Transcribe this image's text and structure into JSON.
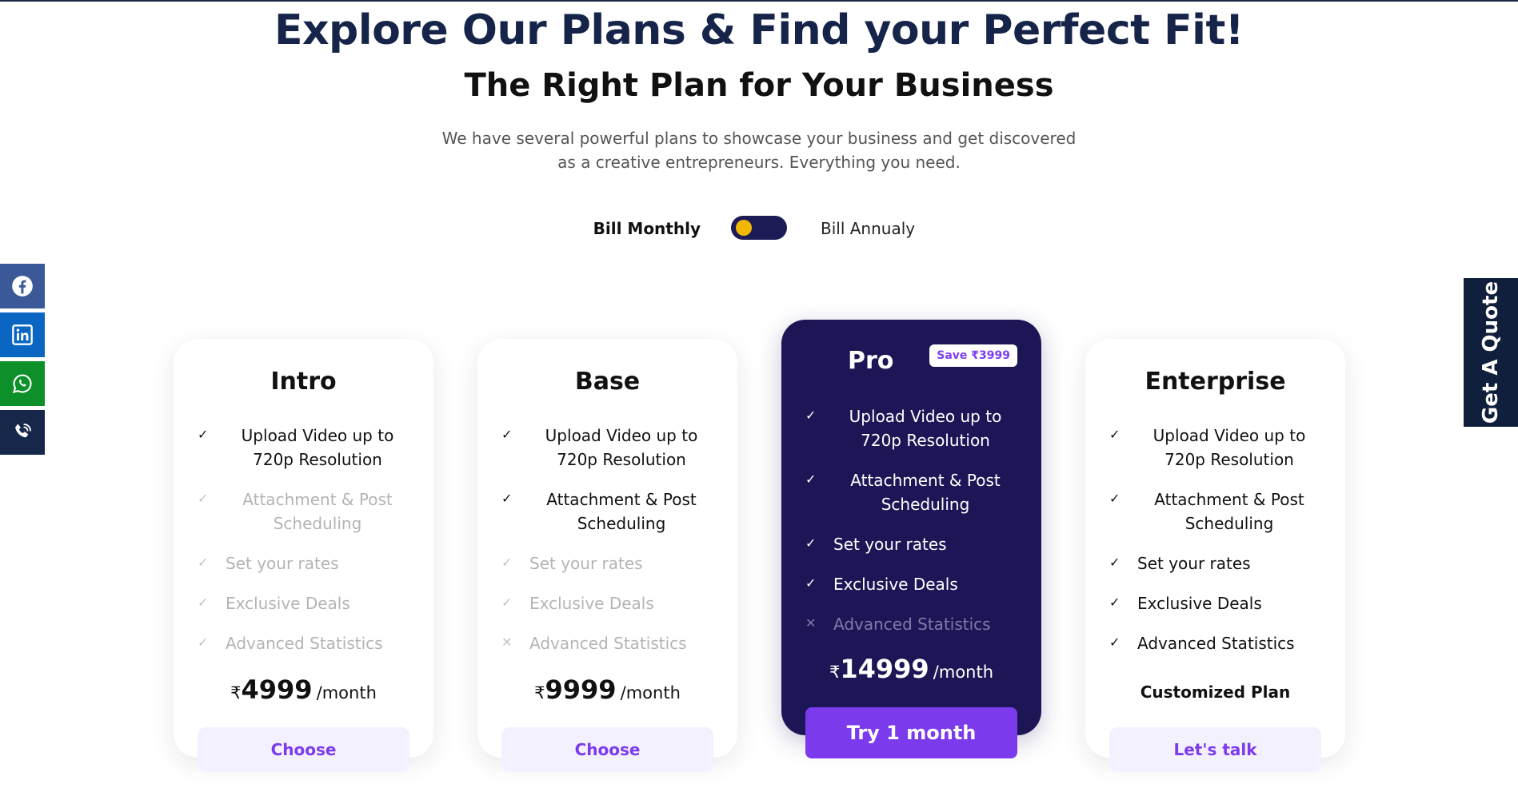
{
  "header": {
    "title": "Explore Our Plans & Find your Perfect Fit!",
    "subtitle": "The Right Plan for Your Business",
    "description_line1": "We have several powerful plans to showcase your business and get discovered",
    "description_line2": "as a creative entrepreneurs. Everything you need."
  },
  "billing": {
    "monthly_label": "Bill Monthly",
    "annual_label": "Bill Annualy",
    "selected": "monthly",
    "toggle_color": "#1d1b56",
    "knob_color": "#f2b705"
  },
  "social": [
    {
      "name": "facebook",
      "icon": "facebook-icon",
      "color": "#3b5998"
    },
    {
      "name": "linkedin",
      "icon": "linkedin-icon",
      "color": "#0a66c2"
    },
    {
      "name": "whatsapp",
      "icon": "whatsapp-icon",
      "color": "#0d8f2a"
    },
    {
      "name": "phone",
      "icon": "phone-icon",
      "color": "#16274a"
    }
  ],
  "quote_tab": {
    "label": "Get A Quote",
    "color": "#0f1f3c"
  },
  "currency_symbol": "₹",
  "plans": {
    "intro": {
      "name": "Intro",
      "features": [
        {
          "label": "Upload Video up to 720p Resolution",
          "line1": "Upload Video up to",
          "line2": "720p Resolution",
          "included": true
        },
        {
          "label": "Attachment & Post Scheduling",
          "line1": "Attachment & Post",
          "line2": "Scheduling",
          "included": false,
          "icon": "check"
        },
        {
          "label": "Set your rates",
          "included": false,
          "icon": "check"
        },
        {
          "label": "Exclusive Deals",
          "included": false,
          "icon": "check"
        },
        {
          "label": "Advanced Statistics",
          "included": false,
          "icon": "check"
        }
      ],
      "price": "4999",
      "period": "/month",
      "button": "Choose"
    },
    "base": {
      "name": "Base",
      "features": [
        {
          "label": "Upload Video up to 720p Resolution",
          "line1": "Upload Video up to",
          "line2": "720p Resolution",
          "included": true
        },
        {
          "label": "Attachment & Post Scheduling",
          "line1": "Attachment & Post",
          "line2": "Scheduling",
          "included": true
        },
        {
          "label": "Set your rates",
          "included": false,
          "icon": "check"
        },
        {
          "label": "Exclusive Deals",
          "included": false,
          "icon": "check"
        },
        {
          "label": "Advanced Statistics",
          "included": false,
          "icon": "cross"
        }
      ],
      "price": "9999",
      "period": "/month",
      "button": "Choose"
    },
    "pro": {
      "name": "Pro",
      "badge": "Save ₹3999",
      "features": [
        {
          "label": "Upload Video up to 720p Resolution",
          "line1": "Upload Video up to",
          "line2": "720p Resolution",
          "included": true
        },
        {
          "label": "Attachment & Post Scheduling",
          "line1": "Attachment & Post",
          "line2": "Scheduling",
          "included": true
        },
        {
          "label": "Set your rates",
          "included": true
        },
        {
          "label": "Exclusive Deals",
          "included": true
        },
        {
          "label": "Advanced Statistics",
          "included": false,
          "icon": "cross"
        }
      ],
      "price": "14999",
      "period": "/month",
      "button": "Try 1 month",
      "highlight_color": "#1d1656",
      "accent_color": "#7c3aed"
    },
    "enterprise": {
      "name": "Enterprise",
      "features": [
        {
          "label": "Upload Video up to 720p Resolution",
          "line1": "Upload Video up to",
          "line2": "720p Resolution",
          "included": true
        },
        {
          "label": "Attachment & Post Scheduling",
          "line1": "Attachment & Post",
          "line2": "Scheduling",
          "included": true
        },
        {
          "label": "Set your rates",
          "included": true
        },
        {
          "label": "Exclusive Deals",
          "included": true
        },
        {
          "label": "Advanced Statistics",
          "included": true
        }
      ],
      "price_text": "Customized Plan",
      "button": "Let's talk"
    }
  }
}
